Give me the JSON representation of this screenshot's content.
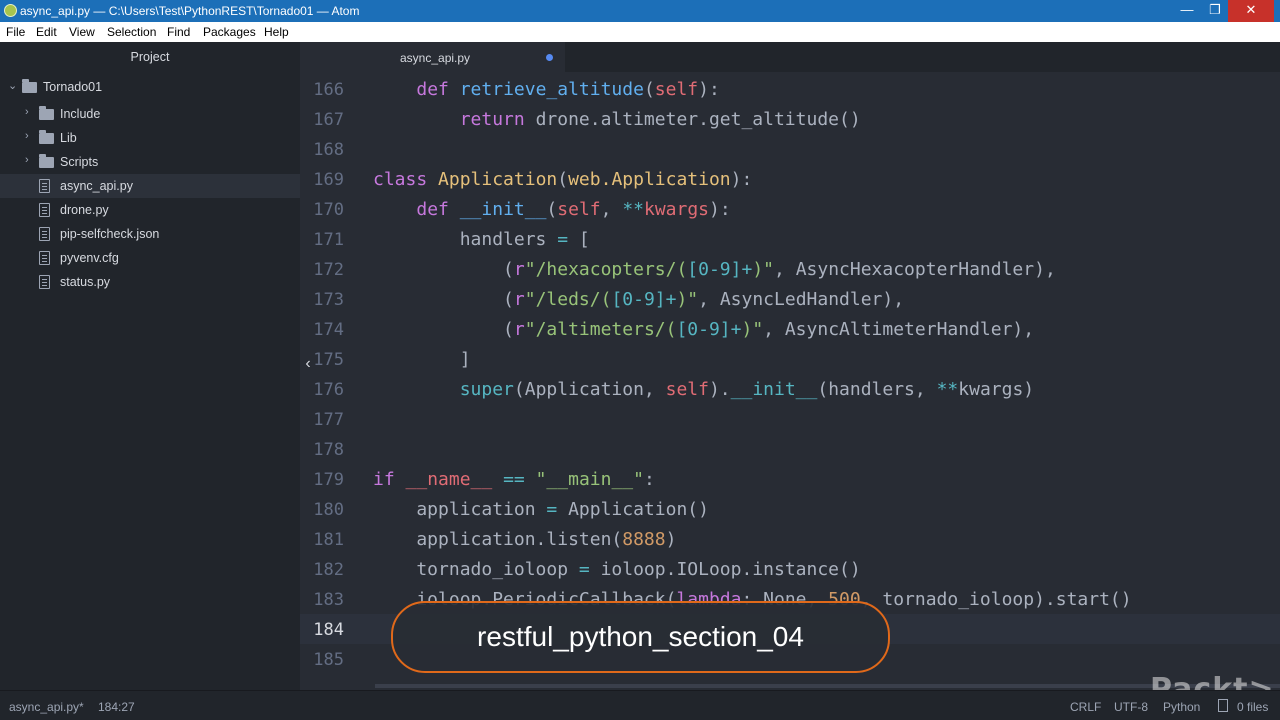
{
  "window": {
    "title": "async_api.py — C:\\Users\\Test\\PythonREST\\Tornado01 — Atom",
    "buttons": {
      "minimize": "—",
      "maximize": "❐",
      "close": "✕"
    }
  },
  "menu": [
    "File",
    "Edit",
    "View",
    "Selection",
    "Find",
    "Packages",
    "Help"
  ],
  "sidebar": {
    "title": "Project",
    "root": "Tornado01",
    "folders": [
      "Include",
      "Lib",
      "Scripts"
    ],
    "files": [
      "async_api.py",
      "drone.py",
      "pip-selfcheck.json",
      "pyvenv.cfg",
      "status.py"
    ],
    "selected": "async_api.py"
  },
  "tabs": [
    {
      "label": "async_api.py",
      "modified": true
    }
  ],
  "editor": {
    "lines": [
      {
        "n": "166",
        "tokens": [
          [
            "pl",
            "    "
          ],
          [
            "kw",
            "def "
          ],
          [
            "fn",
            "retrieve_altitude"
          ],
          [
            "pl",
            "("
          ],
          [
            "self",
            "self"
          ],
          [
            "pl",
            "):"
          ]
        ]
      },
      {
        "n": "167",
        "tokens": [
          [
            "pl",
            "        "
          ],
          [
            "kw",
            "return "
          ],
          [
            "pl",
            "drone.altimeter.get_altitude()"
          ]
        ]
      },
      {
        "n": "168",
        "tokens": []
      },
      {
        "n": "169",
        "tokens": [
          [
            "kw",
            "class "
          ],
          [
            "cls",
            "Application"
          ],
          [
            "pl",
            "("
          ],
          [
            "cls",
            "web.Application"
          ],
          [
            "pl",
            "):"
          ]
        ]
      },
      {
        "n": "170",
        "tokens": [
          [
            "pl",
            "    "
          ],
          [
            "kw",
            "def "
          ],
          [
            "fn",
            "__init__"
          ],
          [
            "pl",
            "("
          ],
          [
            "self",
            "self"
          ],
          [
            "pl",
            ", "
          ],
          [
            "op",
            "**"
          ],
          [
            "self",
            "kwargs"
          ],
          [
            "pl",
            "):"
          ]
        ]
      },
      {
        "n": "171",
        "tokens": [
          [
            "pl",
            "        handlers "
          ],
          [
            "op",
            "="
          ],
          [
            "pl",
            " ["
          ]
        ]
      },
      {
        "n": "172",
        "tokens": [
          [
            "pl",
            "            ("
          ],
          [
            "kw",
            "r"
          ],
          [
            "str",
            "\"/hexacopters/("
          ],
          [
            "op",
            "[0-9]+"
          ],
          [
            "str",
            ")\""
          ],
          [
            "pl",
            ", AsyncHexacopterHandler),"
          ]
        ]
      },
      {
        "n": "173",
        "tokens": [
          [
            "pl",
            "            ("
          ],
          [
            "kw",
            "r"
          ],
          [
            "str",
            "\"/leds/("
          ],
          [
            "op",
            "[0-9]+"
          ],
          [
            "str",
            ")\""
          ],
          [
            "pl",
            ", AsyncLedHandler),"
          ]
        ]
      },
      {
        "n": "174",
        "tokens": [
          [
            "pl",
            "            ("
          ],
          [
            "kw",
            "r"
          ],
          [
            "str",
            "\"/altimeters/("
          ],
          [
            "op",
            "[0-9]+"
          ],
          [
            "str",
            ")\""
          ],
          [
            "pl",
            ", AsyncAltimeterHandler),"
          ]
        ]
      },
      {
        "n": "175",
        "tokens": [
          [
            "pl",
            "        ]"
          ]
        ]
      },
      {
        "n": "176",
        "tokens": [
          [
            "pl",
            "        "
          ],
          [
            "op",
            "super"
          ],
          [
            "pl",
            "(Application, "
          ],
          [
            "self",
            "self"
          ],
          [
            "pl",
            ")."
          ],
          [
            "op",
            "__init__"
          ],
          [
            "pl",
            "(handlers, "
          ],
          [
            "op",
            "**"
          ],
          [
            "pl",
            "kwargs)"
          ]
        ]
      },
      {
        "n": "177",
        "tokens": []
      },
      {
        "n": "178",
        "tokens": []
      },
      {
        "n": "179",
        "tokens": [
          [
            "kw",
            "if "
          ],
          [
            "self",
            "__name__"
          ],
          [
            "pl",
            " "
          ],
          [
            "op",
            "=="
          ],
          [
            "pl",
            " "
          ],
          [
            "str",
            "\"__main__\""
          ],
          [
            "pl",
            ":"
          ]
        ]
      },
      {
        "n": "180",
        "tokens": [
          [
            "pl",
            "    application "
          ],
          [
            "op",
            "="
          ],
          [
            "pl",
            " Application()"
          ]
        ]
      },
      {
        "n": "181",
        "tokens": [
          [
            "pl",
            "    application.listen("
          ],
          [
            "num",
            "8888"
          ],
          [
            "pl",
            ")"
          ]
        ]
      },
      {
        "n": "182",
        "tokens": [
          [
            "pl",
            "    tornado_ioloop "
          ],
          [
            "op",
            "="
          ],
          [
            "pl",
            " ioloop.IOLoop.instance()"
          ]
        ]
      },
      {
        "n": "183",
        "tokens": [
          [
            "pl",
            "    ioloop.PeriodicCallback("
          ],
          [
            "kw",
            "lambda"
          ],
          [
            "pl",
            ": None, "
          ],
          [
            "num",
            "500"
          ],
          [
            "pl",
            ", tornado_ioloop).start()"
          ]
        ]
      },
      {
        "n": "184",
        "tokens": [],
        "cursor": true
      },
      {
        "n": "185",
        "tokens": []
      }
    ]
  },
  "overlay": {
    "text": "restful_python_section_04"
  },
  "watermark": {
    "text": "Packt>"
  },
  "status": {
    "file": "async_api.py*",
    "position": "184:27",
    "line_ending": "CRLF",
    "encoding": "UTF-8",
    "grammar": "Python",
    "files": "0 files"
  },
  "colors": {
    "titlebar": "#1c6fb8",
    "editor_bg": "#282c34",
    "sidebar_bg": "#21252b",
    "overlay_border": "#e0691a"
  }
}
